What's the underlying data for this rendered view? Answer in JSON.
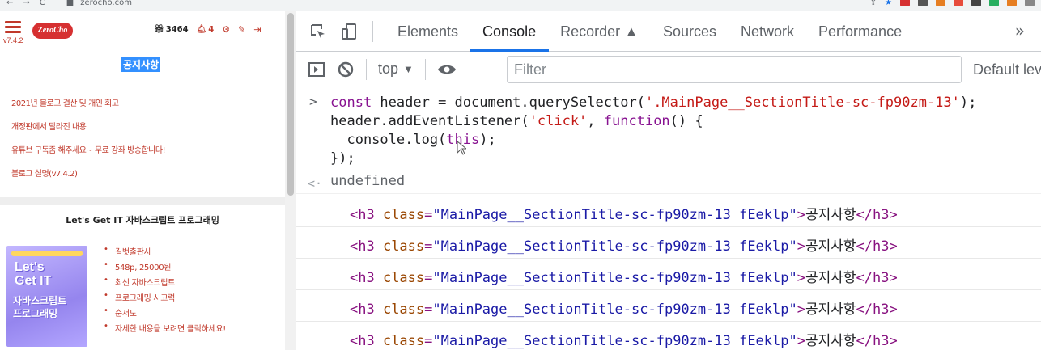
{
  "browser": {
    "url": "zerocho.com"
  },
  "site": {
    "version": "v7.4.2",
    "logo": "ZeroCho",
    "gift_count": "3464",
    "bell_count": "4",
    "notice_title": "공지사항",
    "notices": [
      "2021년 블로그 결산 및 개인 회고",
      "개정판에서 달라진 내용",
      "유튜브 구독좀 해주세요~ 무료 강좌 방송합니다!",
      "블로그 설명(v7.4.2)"
    ],
    "book_title": "Let's Get IT 자바스크립트 프로그래밍",
    "book_cover_lines": [
      "Let's",
      "Get IT",
      "자바스크립트",
      "프로그래밍"
    ],
    "book_info": [
      "길벗출판사",
      "548p, 25000원",
      "최신 자바스크립트",
      "프로그래밍 사고력",
      "순서도",
      "자세한 내용을 보려면 클릭하세요!"
    ]
  },
  "devtools": {
    "tabs": [
      "Elements",
      "Console",
      "Recorder",
      "Sources",
      "Network",
      "Performance"
    ],
    "active_tab": "Console",
    "more": "»",
    "context": "top",
    "filter_placeholder": "Filter",
    "levels": "Default levels",
    "console": {
      "code_lines": [
        "const header = document.querySelector('.MainPage__SectionTitle-sc-fp90zm-13');",
        "header.addEventListener('click', function() {",
        "  console.log(this);",
        "});"
      ],
      "result": "undefined",
      "log_open": "<h3 ",
      "log_attr": "class",
      "log_eq": "=",
      "log_val": "\"MainPage__SectionTitle-sc-fp90zm-13 fEeklp\"",
      "log_gt": ">",
      "log_inner": "공지사항",
      "log_close": "</h3>",
      "log_rows": 5
    }
  }
}
